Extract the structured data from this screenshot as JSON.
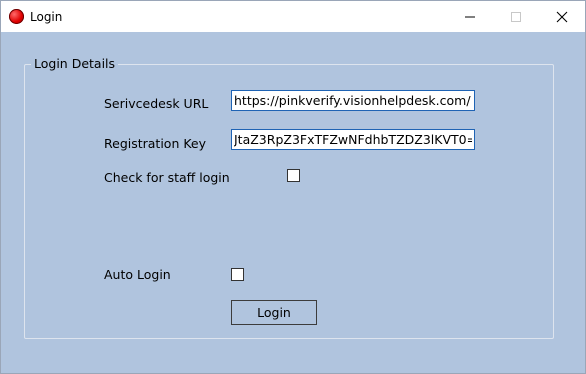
{
  "window": {
    "title": "Login",
    "icon": "red-circle-icon"
  },
  "titlebar_buttons": {
    "minimize_icon": "minimize-icon",
    "maximize_icon": "maximize-icon",
    "close_icon": "close-icon"
  },
  "group": {
    "title": "Login Details"
  },
  "fields": {
    "url_label": "Serivcedesk URL",
    "url_value": "https://pinkverify.visionhelpdesk.com/",
    "key_label": "Registration Key",
    "key_value": "JtaZ3RpZ3FxTFZwNFdhbTZDZ3lKVT0=",
    "staff_label": "Check for staff login",
    "staff_checked": false,
    "auto_label": "Auto Login",
    "auto_checked": false
  },
  "buttons": {
    "login_label": "Login"
  },
  "colors": {
    "background": "#b0c4de",
    "accent": "#1e63b4",
    "title_icon": "#e00000"
  }
}
